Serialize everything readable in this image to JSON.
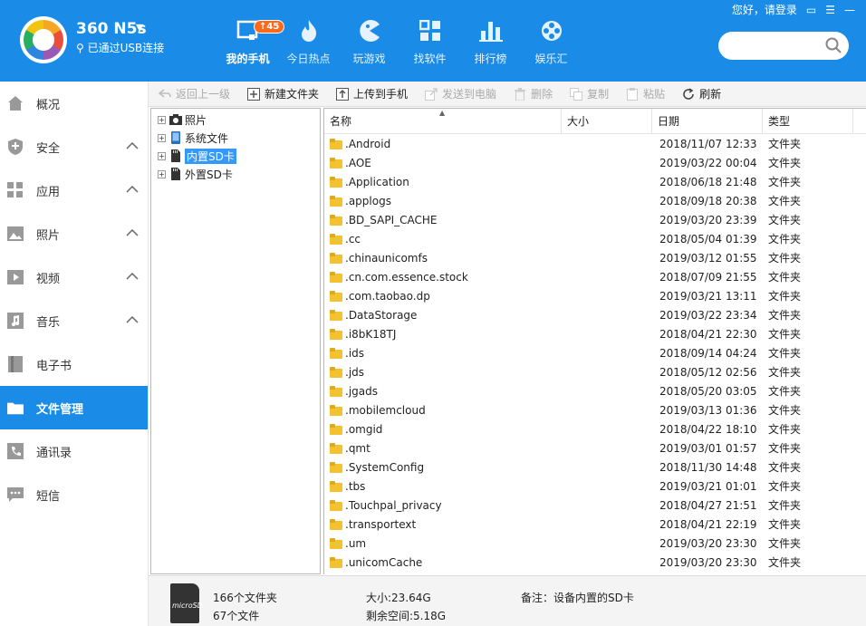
{
  "header": {
    "device_name": "360 N5s",
    "connection_status": "已通过USB连接",
    "badge_count": "↑45",
    "tabs": [
      {
        "label": "我的手机",
        "icon": "phone-monitor-icon",
        "active": true
      },
      {
        "label": "今日热点",
        "icon": "flame-icon",
        "active": false
      },
      {
        "label": "玩游戏",
        "icon": "pacman-icon",
        "active": false
      },
      {
        "label": "找软件",
        "icon": "apps-grid-icon",
        "active": false
      },
      {
        "label": "排行榜",
        "icon": "bar-chart-icon",
        "active": false
      },
      {
        "label": "娱乐汇",
        "icon": "film-reel-icon",
        "active": false
      }
    ],
    "login_text": "您好，请登录",
    "search_placeholder": ""
  },
  "sidebar": {
    "items": [
      {
        "label": "概况",
        "icon": "home-icon",
        "expandable": false
      },
      {
        "label": "安全",
        "icon": "shield-icon",
        "expandable": true
      },
      {
        "label": "应用",
        "icon": "apps-icon",
        "expandable": true
      },
      {
        "label": "照片",
        "icon": "photo-icon",
        "expandable": true
      },
      {
        "label": "视频",
        "icon": "video-icon",
        "expandable": true
      },
      {
        "label": "音乐",
        "icon": "music-icon",
        "expandable": true
      },
      {
        "label": "电子书",
        "icon": "book-icon",
        "expandable": false
      },
      {
        "label": "文件管理",
        "icon": "folder-icon",
        "expandable": false,
        "active": true
      },
      {
        "label": "通讯录",
        "icon": "contacts-icon",
        "expandable": false
      },
      {
        "label": "短信",
        "icon": "sms-icon",
        "expandable": false
      }
    ]
  },
  "toolbar": {
    "back": "返回上一级",
    "new_folder": "新建文件夹",
    "upload": "上传到手机",
    "send_pc": "发送到电脑",
    "delete": "删除",
    "copy": "复制",
    "paste": "粘贴",
    "refresh": "刷新"
  },
  "tree": [
    {
      "label": "照片",
      "icon": "camera-icon",
      "selected": false
    },
    {
      "label": "系统文件",
      "icon": "phone-file-icon",
      "selected": false
    },
    {
      "label": "内置SD卡",
      "icon": "sd-card-icon",
      "selected": true
    },
    {
      "label": "外置SD卡",
      "icon": "sd-card-icon",
      "selected": false
    }
  ],
  "filelist": {
    "columns": {
      "name": "名称",
      "size": "大小",
      "date": "日期",
      "type": "类型"
    },
    "rows": [
      {
        "name": ".Android",
        "size": "",
        "date": "2018/11/07 12:33",
        "type": "文件夹"
      },
      {
        "name": ".AOE",
        "size": "",
        "date": "2019/03/22 00:04",
        "type": "文件夹"
      },
      {
        "name": ".Application",
        "size": "",
        "date": "2018/06/18 21:48",
        "type": "文件夹"
      },
      {
        "name": ".applogs",
        "size": "",
        "date": "2018/09/18 20:38",
        "type": "文件夹"
      },
      {
        "name": ".BD_SAPI_CACHE",
        "size": "",
        "date": "2019/03/20 23:39",
        "type": "文件夹"
      },
      {
        "name": ".cc",
        "size": "",
        "date": "2018/05/04 01:39",
        "type": "文件夹"
      },
      {
        "name": ".chinaunicomfs",
        "size": "",
        "date": "2019/03/12 01:55",
        "type": "文件夹"
      },
      {
        "name": ".cn.com.essence.stock",
        "size": "",
        "date": "2018/07/09 21:55",
        "type": "文件夹"
      },
      {
        "name": ".com.taobao.dp",
        "size": "",
        "date": "2019/03/21 13:11",
        "type": "文件夹"
      },
      {
        "name": ".DataStorage",
        "size": "",
        "date": "2019/03/22 23:34",
        "type": "文件夹"
      },
      {
        "name": ".i8bK18TJ",
        "size": "",
        "date": "2018/04/21 22:30",
        "type": "文件夹"
      },
      {
        "name": ".ids",
        "size": "",
        "date": "2018/09/14 04:24",
        "type": "文件夹"
      },
      {
        "name": ".jds",
        "size": "",
        "date": "2018/05/12 02:56",
        "type": "文件夹"
      },
      {
        "name": ".jgads",
        "size": "",
        "date": "2018/05/20 03:05",
        "type": "文件夹"
      },
      {
        "name": ".mobilemcloud",
        "size": "",
        "date": "2019/03/13 01:36",
        "type": "文件夹"
      },
      {
        "name": ".omgid",
        "size": "",
        "date": "2018/04/22 18:10",
        "type": "文件夹"
      },
      {
        "name": ".qmt",
        "size": "",
        "date": "2019/03/01 01:57",
        "type": "文件夹"
      },
      {
        "name": ".SystemConfig",
        "size": "",
        "date": "2018/11/30 14:48",
        "type": "文件夹"
      },
      {
        "name": ".tbs",
        "size": "",
        "date": "2019/03/21 01:01",
        "type": "文件夹"
      },
      {
        "name": ".Touchpal_privacy",
        "size": "",
        "date": "2018/04/27 21:51",
        "type": "文件夹"
      },
      {
        "name": ".transportext",
        "size": "",
        "date": "2018/04/21 22:19",
        "type": "文件夹"
      },
      {
        "name": ".um",
        "size": "",
        "date": "2019/03/20 23:30",
        "type": "文件夹"
      },
      {
        "name": ".unicomCache",
        "size": "",
        "date": "2019/03/20 23:30",
        "type": "文件夹"
      }
    ]
  },
  "status": {
    "folders": "166个文件夹",
    "files": "67个文件",
    "size": "大小:23.64G",
    "free": "剩余空间:5.18G",
    "note": "备注：设备内置的SD卡",
    "sd_label": "microSD"
  }
}
